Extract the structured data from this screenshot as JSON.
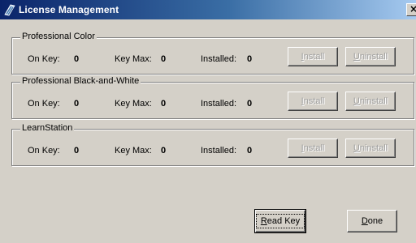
{
  "window": {
    "title": "License Management",
    "close_label": "×",
    "title_icon": "app-icon"
  },
  "groups": [
    {
      "name": "Professional Color",
      "on_key_label": "On Key:",
      "on_key_value": "0",
      "key_max_label": "Key Max:",
      "key_max_value": "0",
      "installed_label": "Installed:",
      "installed_value": "0",
      "install_label": "Install",
      "install_accel": "I",
      "install_rest": "nstall",
      "uninstall_label": "Uninstall",
      "uninstall_accel": "U",
      "uninstall_rest": "ninstall"
    },
    {
      "name": "Professional Black-and-White",
      "on_key_label": "On Key:",
      "on_key_value": "0",
      "key_max_label": "Key Max:",
      "key_max_value": "0",
      "installed_label": "Installed:",
      "installed_value": "0",
      "install_label": "Install",
      "install_accel": "I",
      "install_rest": "nstall",
      "uninstall_label": "Uninstall",
      "uninstall_accel": "U",
      "uninstall_rest": "ninstall"
    },
    {
      "name": "LearnStation",
      "on_key_label": "On Key:",
      "on_key_value": "0",
      "key_max_label": "Key Max:",
      "key_max_value": "0",
      "installed_label": "Installed:",
      "installed_value": "0",
      "install_label": "Install",
      "install_accel": "I",
      "install_rest": "nstall",
      "uninstall_label": "Uninstall",
      "uninstall_accel": "U",
      "uninstall_rest": "ninstall"
    }
  ],
  "footer": {
    "read_key_accel": "R",
    "read_key_rest": "ead Key",
    "done_accel": "D",
    "done_rest": "one"
  },
  "colors": {
    "titlebar_start": "#0a246a",
    "titlebar_end": "#a6caf0",
    "face": "#d4d0c8",
    "disabled_text": "#a0a0a0"
  }
}
